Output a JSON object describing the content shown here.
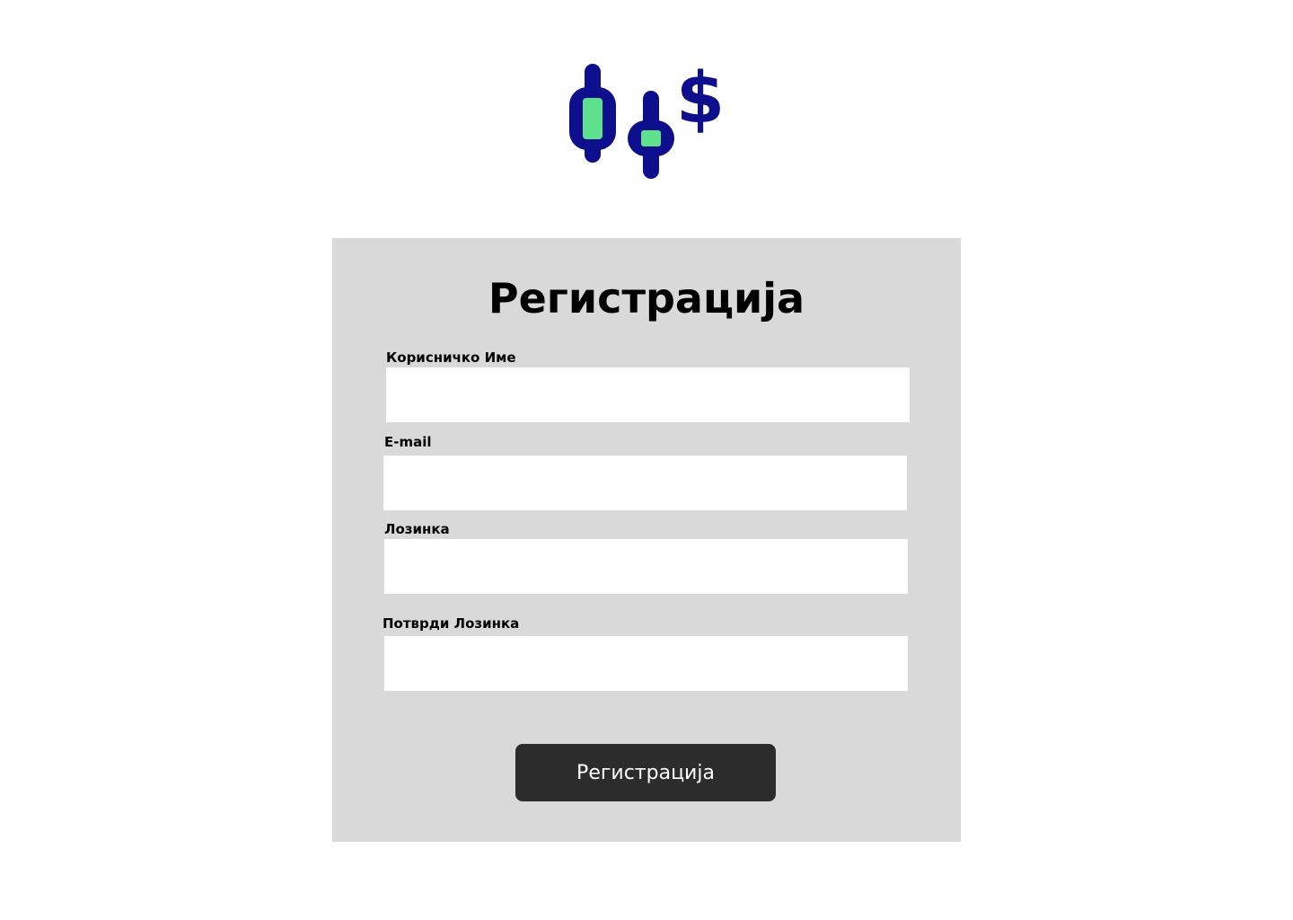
{
  "logo": {
    "icon": "candlestick-dollar-icon",
    "primary_color": "#0d0f8c",
    "accent_color": "#5fe08c"
  },
  "form": {
    "title": "Регистрација",
    "fields": [
      {
        "label": "Корисничко Име",
        "value": "",
        "placeholder": ""
      },
      {
        "label": "E-mail",
        "value": "",
        "placeholder": ""
      },
      {
        "label": "Лозинка",
        "value": "",
        "placeholder": ""
      },
      {
        "label": "Потврди Лозинка",
        "value": "",
        "placeholder": ""
      }
    ],
    "submit_label": "Регистрација"
  },
  "colors": {
    "card_background": "#d9d9d9",
    "button_background": "#2c2c2c",
    "button_text": "#ffffff"
  }
}
